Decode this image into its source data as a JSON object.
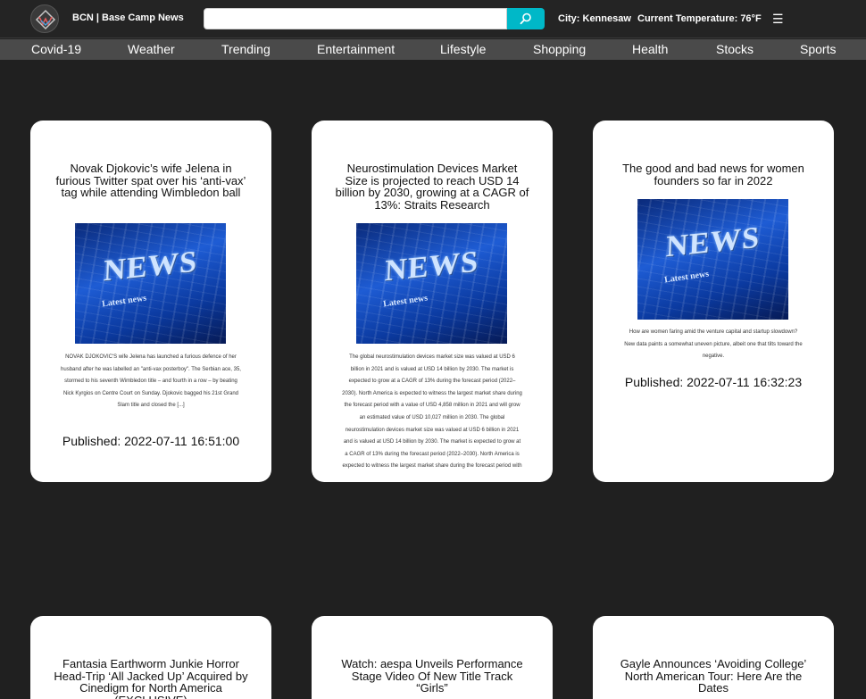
{
  "header": {
    "brand": "BCN | Base Camp News",
    "search": {
      "value": "",
      "placeholder": ""
    },
    "city": "City: Kennesaw",
    "temperature": "Current Temperature: 76°F",
    "menu_glyph": "☰",
    "accent_color": "#00b8c8"
  },
  "nav": {
    "items": [
      "Covid-19",
      "Weather",
      "Trending",
      "Entertainment",
      "Lifestyle",
      "Shopping",
      "Health",
      "Stocks",
      "Sports"
    ]
  },
  "cards": [
    {
      "title": "Novak Djokovic’s wife Jelena in furious Twitter spat over his ‘anti-vax’ tag while attending Wimbledon ball",
      "image_text": "NEWS",
      "image_sub": "Latest news",
      "description": "NOVAK DJOKOVIC'S wife Jelena has launched a furious defence of her husband after he was labelled an \"anti-vax posterboy\". The Serbian ace, 35, stormed to his seventh Wimbledon title – and fourth in a row – by beating Nick Kyrgios on Centre Court on Sunday. Djokovic bagged his 21st Grand Slam title and closed the [...]",
      "published": "Published: 2022-07-11 16:51:00"
    },
    {
      "title": "Neurostimulation Devices Market Size is projected to reach USD 14 billion by 2030, growing at a CAGR of 13%: Straits Research",
      "image_text": "NEWS",
      "image_sub": "Latest news",
      "description": "The global neurostimulation devices market size was valued at USD 6 billion in 2021 and is valued at USD 14 billion by 2030. The market is expected to grow at a CAGR of 13% during the forecast period (2022–2030). North America is expected to witness the largest market share during the forecast period with a value of USD 4,858 million in 2021 and will grow an estimated value of USD 10,027 million in 2030. The global neurostimulation devices market size was valued at USD 6 billion in 2021 and is valued at USD 14 billion by 2030. The market is expected to grow at a CAGR of 13% during the forecast period (2022–2030). North America is expected to witness the largest market share during the forecast period with",
      "published": ""
    },
    {
      "title": "The good and bad news for women founders so far in 2022",
      "image_text": "NEWS",
      "image_sub": "Latest news",
      "description": "How are women faring amid the venture capital and startup slowdown? New data paints a somewhat uneven picture, albeit one that tilts toward the negative.",
      "published": "Published: 2022-07-11 16:32:23"
    },
    {
      "title": "Fantasia Earthworm Junkie Horror Head-Trip ‘All Jacked Up’ Acquired by Cinedigm for North America (EXCLUSIVE)",
      "image_text": "",
      "image_sub": "",
      "description": "",
      "published": ""
    },
    {
      "title": "Watch: aespa Unveils Performance Stage Video Of New Title Track “Girls”",
      "image_text": "",
      "image_sub": "",
      "description": "",
      "published": ""
    },
    {
      "title": "Gayle Announces ‘Avoiding College’ North American Tour: Here Are the Dates",
      "image_text": "",
      "image_sub": "",
      "description": "",
      "published": ""
    }
  ]
}
